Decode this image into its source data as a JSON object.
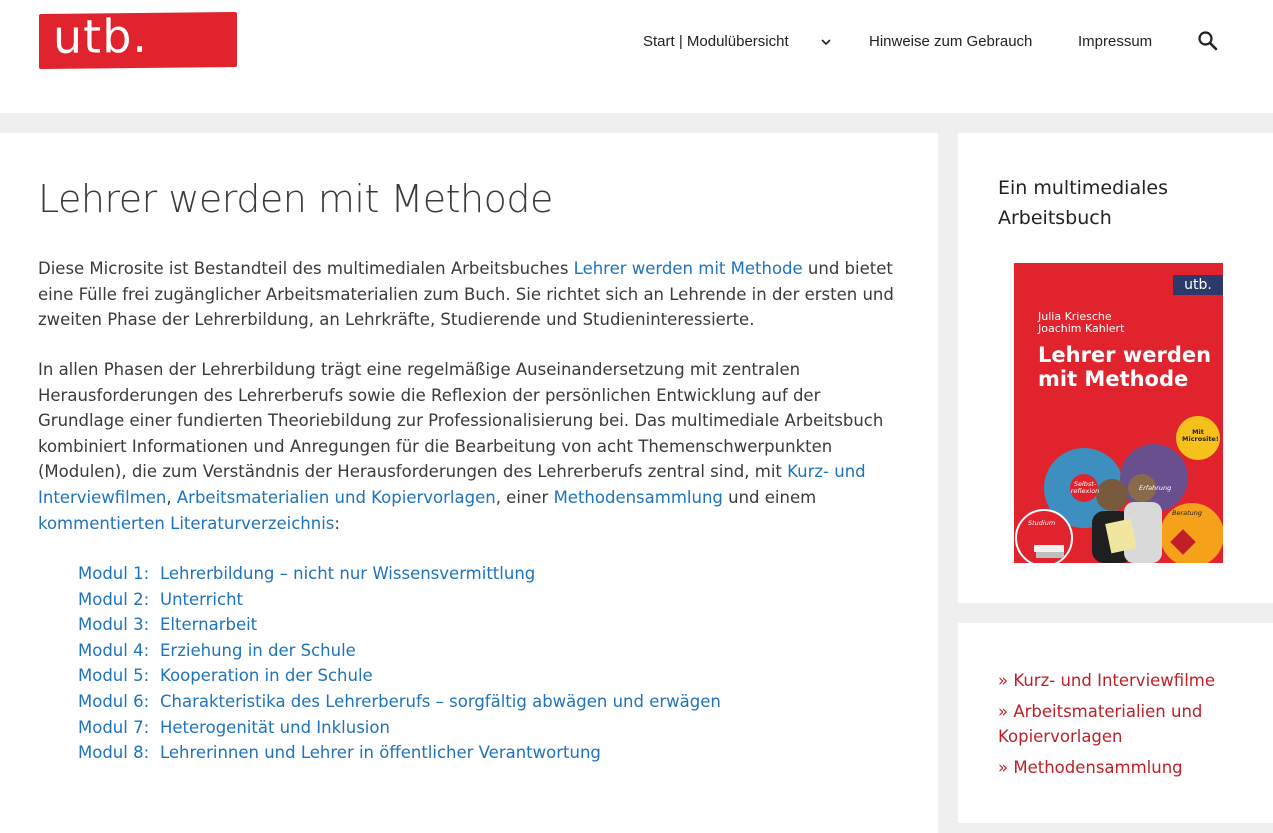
{
  "header": {
    "logo_text": "utb.",
    "nav": {
      "start": "Start | Modulübersicht",
      "hinweise": "Hinweise zum Gebrauch",
      "impressum": "Impressum"
    }
  },
  "main": {
    "title": "Lehrer werden mit Methode",
    "para1": {
      "t1": "Diese Microsite ist Bestandteil des multimedialen Arbeitsbuches ",
      "link": "Lehrer werden mit Methode",
      "t2": " und bietet eine Fülle frei zugänglicher Arbeitsmaterialien zum Buch. Sie richtet sich an Lehrende in der ersten und zweiten Phase der Lehrerbildung, an Lehrkräfte, Studierende und Studieninteressierte."
    },
    "para2": {
      "t1": "In allen Phasen der Lehrerbildung trägt eine regelmäßige Auseinandersetzung mit zentralen Herausforderungen des Lehrerberufs sowie die Reflexion der persönlichen Entwicklung auf der Grundlage einer fundierten Theoriebildung zur Professionalisierung bei. Das multimediale Arbeitsbuch kombiniert Informationen und Anregungen für die Bearbeitung von acht Themenschwerpunkten (Modulen), die zum Verständnis der Herausforderungen des Lehrerberufs zentral sind, mit ",
      "link1": "Kurz- und Interviewfilmen",
      "t2": ", ",
      "link2": "Arbeitsmaterialien und Kopiervorlagen",
      "t3": ", einer ",
      "link3": "Methodensammlung",
      "t4": " und einem ",
      "link4": "kommentierten Literaturverzeichnis",
      "t5": ":"
    },
    "modules": [
      {
        "num": "Modul 1:",
        "title": "Lehrerbildung – nicht nur Wissensvermittlung"
      },
      {
        "num": "Modul 2:",
        "title": "Unterricht"
      },
      {
        "num": "Modul 3:",
        "title": "Elternarbeit"
      },
      {
        "num": "Modul 4:",
        "title": "Erziehung in der Schule"
      },
      {
        "num": "Modul 5:",
        "title": "Kooperation in der Schule"
      },
      {
        "num": "Modul 6:",
        "title": "Charakteristika des Lehrerberufs – sorgfältig abwägen und erwägen"
      },
      {
        "num": "Modul 7:",
        "title": "Heterogenität und Inklusion"
      },
      {
        "num": "Modul 8:",
        "title": "Lehrerinnen und Lehrer in öffentlicher Verantwortung"
      }
    ]
  },
  "sidebar": {
    "widget_title": "Ein multimediales Arbeitsbuch",
    "book": {
      "publisher": "utb.",
      "authors": [
        "Julia Kriesche",
        "Joachim Kahlert"
      ],
      "title_line1": "Lehrer werden",
      "title_line2": "mit Methode",
      "badge": "Mit Microsite!",
      "gear_labels": [
        "Selbst-reflexion",
        "Erfahrung",
        "Studium",
        "Beratung"
      ]
    },
    "links": [
      "» Kurz- und Interviewfilme",
      "» Arbeitsmaterialien und Kopiervorlagen",
      "» Methodensammlung"
    ]
  },
  "colors": {
    "brand_red": "#e1232d",
    "link_blue": "#1e73be",
    "sidebar_link_red": "#c01f27"
  }
}
